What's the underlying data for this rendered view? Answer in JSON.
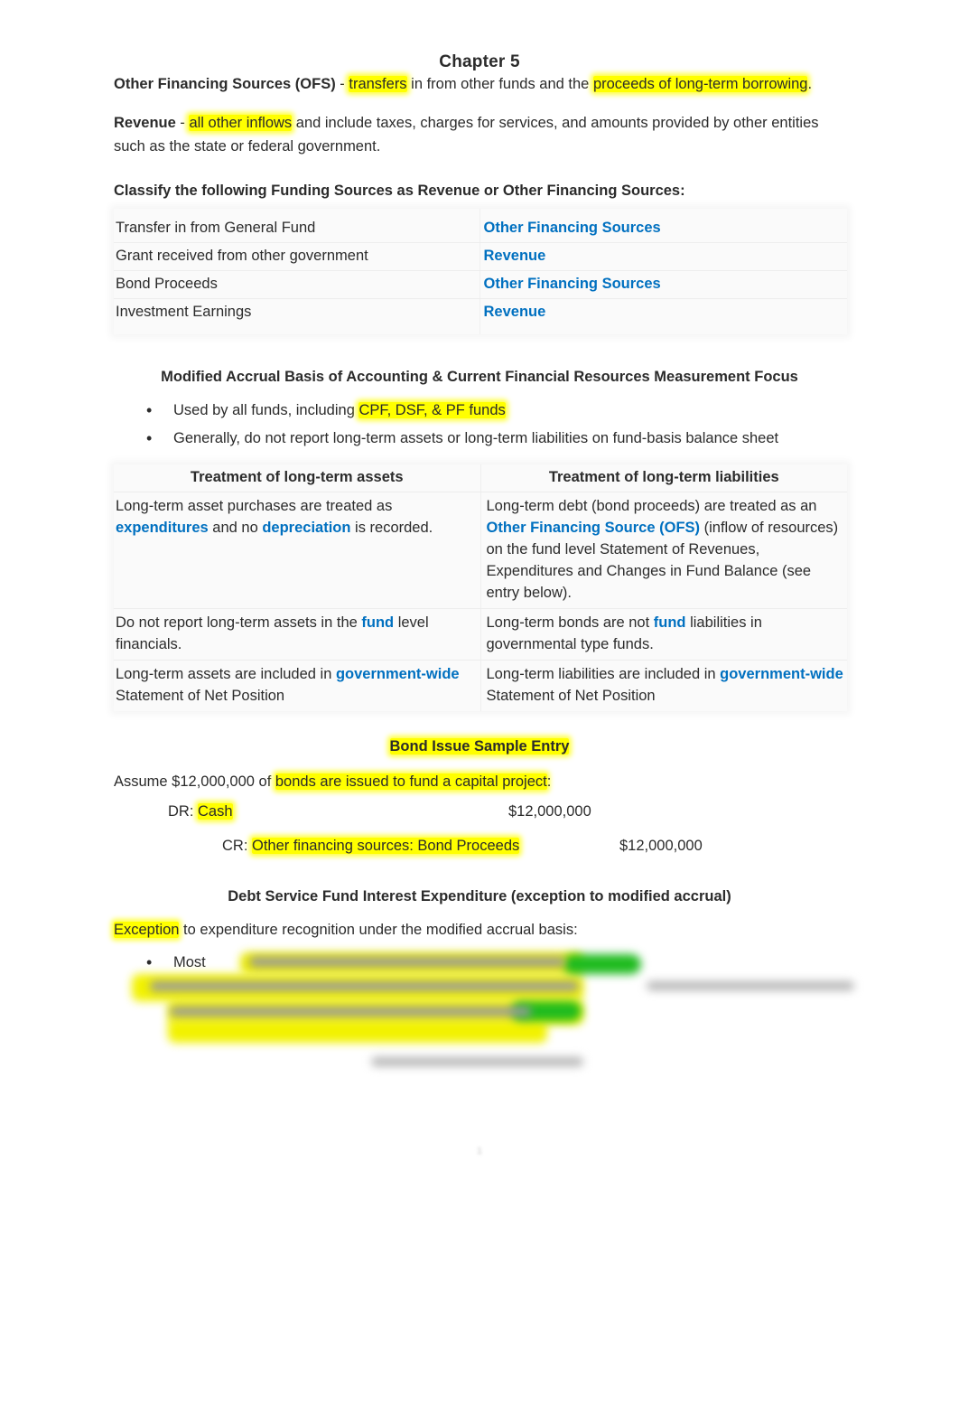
{
  "document": {
    "title": "Chapter 5",
    "page_number": "1"
  },
  "definitions": {
    "ofs": {
      "term": "Other Financing Sources (OFS)",
      "dash": " - ",
      "hl1": "transfers",
      "mid": " in from other funds and the ",
      "hl2": "proceeds of long-term borrowing",
      "end": "."
    },
    "revenue": {
      "term": "Revenue",
      "dash": " - ",
      "hl1": "all other inflows",
      "rest": " and include taxes, charges for services, and amounts provided by other entities such as the state or federal government."
    }
  },
  "classify": {
    "prompt": "Classify the following Funding Sources as Revenue or Other Financing Sources:",
    "rows": [
      {
        "source": "Transfer in from General Fund",
        "answer": "Other Financing Sources"
      },
      {
        "source": "Grant received from other government",
        "answer": "Revenue"
      },
      {
        "source": "Bond Proceeds",
        "answer": "Other Financing Sources"
      },
      {
        "source": "Investment Earnings",
        "answer": "Revenue"
      }
    ]
  },
  "modified_accrual": {
    "heading": "Modified Accrual Basis of Accounting & Current Financial Resources Measurement Focus",
    "bullet1_pre": "Used by all  funds, including ",
    "bullet1_hl": "CPF, DSF, & PF funds",
    "bullet2": "Generally, do not report long-term assets or long-term liabilities on fund-basis balance sheet"
  },
  "treatment": {
    "header_assets": "Treatment of long-term assets",
    "header_liabilities": "Treatment of long-term liabilities",
    "assets_r1_a": "Long-term asset purchases are treated as ",
    "assets_r1_b": "expenditures",
    "assets_r1_c": " and no ",
    "assets_r1_d": "depreciation",
    "assets_r1_e": " is recorded.",
    "liab_r1_a": "Long-term debt (bond proceeds) are treated as an ",
    "liab_r1_b": "Other Financing Source (OFS)",
    "liab_r1_c": " (inflow of resources) on the fund level Statement of Revenues, Expenditures and Changes in Fund Balance (see entry below).",
    "assets_r2_a": "Do not report long-term assets in the ",
    "assets_r2_b": "fund",
    "assets_r2_c": " level financials.",
    "liab_r2_a": "Long-term bonds are not ",
    "liab_r2_b": "fund",
    "liab_r2_c": " liabilities in governmental type funds.",
    "assets_r3_a": "Long-term assets are included in ",
    "assets_r3_b": "government-wide",
    "assets_r3_c": " Statement of Net Position",
    "liab_r3_a": "Long-term liabilities are included in ",
    "liab_r3_b": "government-wide",
    "liab_r3_c": " Statement of Net Position"
  },
  "bond_entry": {
    "heading": "Bond Issue Sample Entry",
    "assume_pre": "Assume $12,000,000 of ",
    "assume_hl": "bonds are issued to fund a capital project",
    "assume_post": ":",
    "dr_label_pre": "DR: ",
    "dr_label_hl": "Cash",
    "dr_amount": "$12,000,000",
    "cr_label_pre": "CR: ",
    "cr_label_hl": "Other financing sources: Bond Proceeds",
    "cr_amount": "$12,000,000"
  },
  "dsf_interest": {
    "heading": "Debt Service Fund Interest Expenditure (exception to modified accrual)",
    "intro_hl": "Exception",
    "intro_rest": " to expenditure recognition under the modified accrual basis:",
    "bullet_visible": "Most"
  },
  "colors": {
    "highlight_yellow": "#ffff00",
    "highlight_green": "#1fbb1f",
    "accent_blue": "#0070c0",
    "text": "#2b2b2b",
    "table_bg": "#fafafa"
  }
}
